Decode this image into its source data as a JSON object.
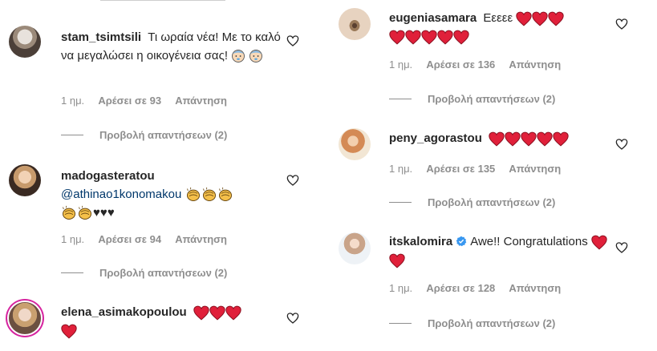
{
  "comments_left": [
    {
      "username": "stam_tsimtsili",
      "text": "Τι ωραία νέα! Με το καλό να μεγαλώσει η οικογένεια σας!",
      "trailing_emoji": [
        "baby-face-icon",
        "baby-face-icon"
      ],
      "time": "1 ημ.",
      "likes": "Αρέσει σε 93",
      "reply": "Απάντηση",
      "view_replies": "Προβολή απαντήσεων (2)"
    },
    {
      "username": "madogasteratou",
      "mention": "@athinao1konomakou",
      "emoji_line1": [
        "clapping-hands-icon",
        "clapping-hands-icon",
        "clapping-hands-icon"
      ],
      "emoji_line2": [
        "clapping-hands-icon",
        "clapping-hands-icon"
      ],
      "text_suffix": "♥♥♥",
      "time": "1 ημ.",
      "likes": "Αρέσει σε 94",
      "reply": "Απάντηση",
      "view_replies": "Προβολή απαντήσεων (2)"
    },
    {
      "username": "elena_asimakopoulou",
      "hearts": 4
    }
  ],
  "comments_right": [
    {
      "username": "eugeniasamara",
      "text": "Εεεεε",
      "hearts": 8,
      "time": "1 ημ.",
      "likes": "Αρέσει σε 136",
      "reply": "Απάντηση",
      "view_replies": "Προβολή απαντήσεων (2)"
    },
    {
      "username": "peny_agorastou",
      "hearts": 5,
      "time": "1 ημ.",
      "likes": "Αρέσει σε 135",
      "reply": "Απάντηση",
      "view_replies": "Προβολή απαντήσεων (2)"
    },
    {
      "username": "itskalomira",
      "verified": true,
      "text": "Awe!! Congratulations",
      "hearts": 2,
      "time": "1 ημ.",
      "likes": "Αρέσει σε 128",
      "reply": "Απάντηση",
      "view_replies": "Προβολή απαντήσεων (2)"
    }
  ],
  "colors": {
    "heart_red": "#e0203a",
    "meta_gray": "#8e8e8e",
    "mention_blue": "#00376b",
    "verified_blue": "#3897f0"
  }
}
